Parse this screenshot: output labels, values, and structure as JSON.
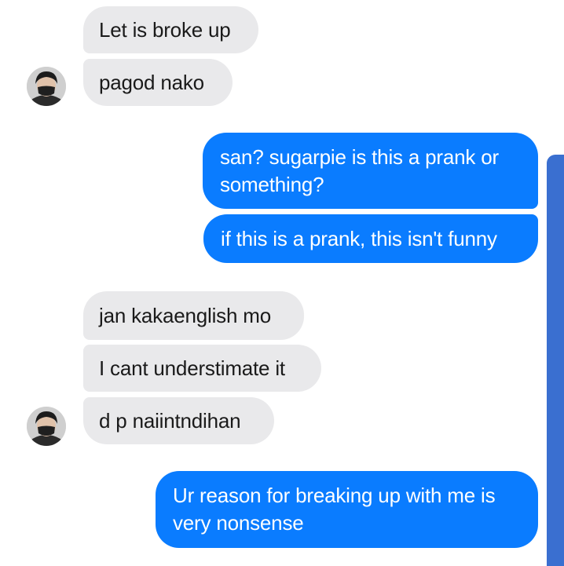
{
  "conversation": {
    "messages": [
      {
        "from": "contact",
        "text": "Let is broke up"
      },
      {
        "from": "contact",
        "text": "pagod nako"
      },
      {
        "from": "me",
        "text": "san? sugarpie is this a prank or something?"
      },
      {
        "from": "me",
        "text": "if this is a prank, this isn't funny"
      },
      {
        "from": "contact",
        "text": "jan kakaenglish mo"
      },
      {
        "from": "contact",
        "text": "I cant understimate it"
      },
      {
        "from": "contact",
        "text": "d p naiintndihan"
      },
      {
        "from": "me",
        "text": "Ur reason for breaking up with me is very nonsense"
      }
    ]
  },
  "avatar": {
    "icon": "contact-avatar",
    "description": "masked person"
  },
  "colors": {
    "sent_bubble": "#0a7cff",
    "received_bubble": "#e9e9eb",
    "scrollbar": "#3a6fd0"
  }
}
